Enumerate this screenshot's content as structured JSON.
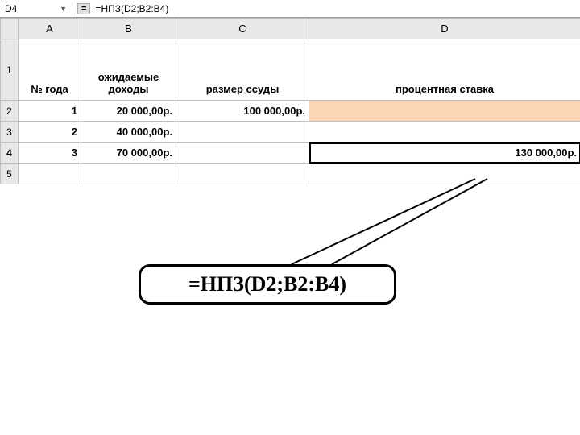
{
  "formula_bar": {
    "cell_ref": "D4",
    "formula": "=НПЗ(D2;B2:B4)"
  },
  "columns": [
    "A",
    "B",
    "C",
    "D"
  ],
  "rows": [
    "1",
    "2",
    "3",
    "4",
    "5"
  ],
  "headers": {
    "a": "№ года",
    "b": "ожидаемые доходы",
    "c": "размер ссуды",
    "d": "процентная ставка"
  },
  "chart_data": {
    "type": "table",
    "columns": [
      "№ года",
      "ожидаемые доходы",
      "размер ссуды",
      "процентная ставка"
    ],
    "rows": [
      [
        "1",
        "20 000,00р.",
        "100 000,00р.",
        ""
      ],
      [
        "2",
        "40 000,00р.",
        "",
        ""
      ],
      [
        "3",
        "70 000,00р.",
        "",
        "130 000,00р."
      ]
    ]
  },
  "cells": {
    "a2": "1",
    "b2": "20 000,00р.",
    "c2": "100 000,00р.",
    "a3": "2",
    "b3": "40 000,00р.",
    "a4": "3",
    "b4": "70 000,00р.",
    "d4": "130 000,00р."
  },
  "callout": "=НПЗ(D2;B2:B4)"
}
